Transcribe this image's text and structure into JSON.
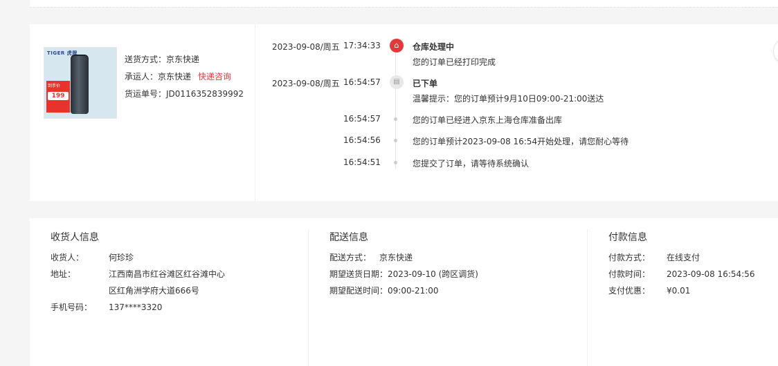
{
  "shipping": {
    "method_label": "送货方式：",
    "method_value": "京东快递",
    "carrier_label": "承运人：",
    "carrier_value": "京东快递",
    "carrier_link": "快递咨询",
    "tracking_label": "货运单号：",
    "tracking_value": "JD0116352839992"
  },
  "product_image": {
    "brand": "TIGER 虎牌",
    "promo_text": "到手价",
    "price": "199"
  },
  "timeline": {
    "items": [
      {
        "date": "2023-09-08/周五",
        "time": "17:34:33",
        "title": "仓库处理中",
        "desc": "您的订单已经打印完成",
        "icon": "warehouse-icon"
      },
      {
        "date": "2023-09-08/周五",
        "time": "16:54:57",
        "title": "已下单",
        "desc": "温馨提示：您的订单预计9月10日09:00-21:00送达",
        "icon": "order-icon"
      },
      {
        "time": "16:54:57",
        "desc": "您的订单已经进入京东上海仓库准备出库"
      },
      {
        "time": "16:54:56",
        "desc": "您的订单预计2023-09-08 16:54开始处理，请您耐心等待"
      },
      {
        "time": "16:54:51",
        "desc": "您提交了订单，请等待系统确认"
      }
    ]
  },
  "receiver": {
    "title": "收货人信息",
    "name_label": "收货人：",
    "name_value": "何珍珍",
    "address_label": "地址：",
    "address_line1": "江西南昌市红谷滩区红谷滩中心",
    "address_line2": "区红角洲学府大道666号",
    "phone_label": "手机号码：",
    "phone_value": "137****3320"
  },
  "delivery": {
    "title": "配送信息",
    "method_label": "配送方式：",
    "method_value": "京东快递",
    "date_label": "期望送货日期：",
    "date_value": "2023-09-10 (跨区调货)",
    "time_label": "期望配送时间：",
    "time_value": "09:00-21:00"
  },
  "payment": {
    "title": "付款信息",
    "method_label": "付款方式：",
    "method_value": "在线支付",
    "time_label": "付款时间：",
    "time_value": "2023-09-08 16:54:56",
    "discount_label": "支付优惠：",
    "discount_value": "¥0.01"
  },
  "colors": {
    "accent": "#e4393c",
    "text": "#333333",
    "background": "#f5f5f5"
  }
}
